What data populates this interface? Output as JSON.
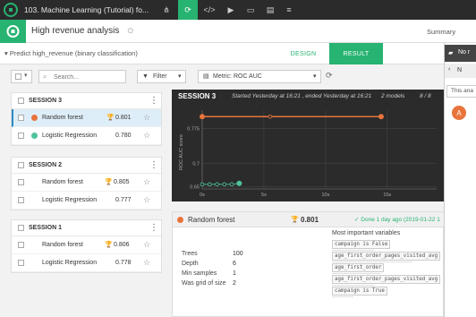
{
  "topbar": {
    "project_title": "103. Machine Learning (Tutorial) fo...",
    "icons": [
      "share-icon",
      "recycle-icon",
      "code-icon",
      "play-icon",
      "dashboard-icon",
      "notebook-icon",
      "menu-icon"
    ]
  },
  "subbar": {
    "analysis_title": "High revenue analysis",
    "summary_label": "Summary"
  },
  "tabbar": {
    "predict_label": "Predict high_revenue (binary classification)",
    "design_label": "DESIGN",
    "result_label": "RESULT"
  },
  "filterbar": {
    "search_placeholder": "Search...",
    "filter_label": "Filter",
    "metric_label": "Metric: ROC AUC"
  },
  "sessions": [
    {
      "title": "SESSION 3",
      "models": [
        {
          "name": "Random forest",
          "score": "0.801",
          "color": "#e8743b"
        },
        {
          "name": "Logistic Regression",
          "score": "0.780",
          "color": "#4fc39a"
        }
      ]
    },
    {
      "title": "SESSION 2",
      "models": [
        {
          "name": "Random forest",
          "score": "0.805"
        },
        {
          "name": "Logistic Regression",
          "score": "0.777"
        }
      ]
    },
    {
      "title": "SESSION 1",
      "models": [
        {
          "name": "Random forest",
          "score": "0.806"
        },
        {
          "name": "Logistic Regression",
          "score": "0.778"
        }
      ]
    }
  ],
  "chart_panel": {
    "session": "SESSION 3",
    "started": "Started Yesterday at 16:21 , ended Yesterday at 16:21",
    "models_count": "2 models",
    "progress": "8 / 8"
  },
  "chart_data": {
    "type": "line",
    "ylabel": "ROC AUC score",
    "xlabel": "",
    "x_ticks": [
      "0s",
      "5s",
      "10s",
      "15s"
    ],
    "y_ticks": [
      "0.775",
      "0.7",
      "0.65"
    ],
    "xlim": [
      0,
      19
    ],
    "series": [
      {
        "color": "#e8743b",
        "x": [
          0,
          5.5,
          14.5
        ],
        "y": [
          0.801,
          0.801,
          0.801
        ]
      },
      {
        "color": "#4fc39a",
        "x": [
          0,
          0.6,
          1.2,
          1.8,
          2.4,
          3.0
        ],
        "y": [
          0.655,
          0.655,
          0.655,
          0.655,
          0.655,
          0.657
        ]
      }
    ]
  },
  "detail": {
    "model_name": "Random forest",
    "score": "0.801",
    "done_label": "Done 1 day ago (2019-01-22 1",
    "params": [
      {
        "label": "Trees",
        "value": "100"
      },
      {
        "label": "Depth",
        "value": "6"
      },
      {
        "label": "Min samples",
        "value": "1"
      },
      {
        "label": "Was grid of size",
        "value": "2"
      }
    ],
    "vars_title": "Most important variables",
    "vars": [
      {
        "label": "campaign is False",
        "importance": 0.4
      },
      {
        "label": "age_first_order_pages_visited_avg",
        "importance": 0.75
      },
      {
        "label": "age_first_order",
        "importance": 0.45
      },
      {
        "label": "age_first_order_pages_visited_avg",
        "importance": 0.4
      },
      {
        "label": "campaign is True",
        "importance": 0.2
      }
    ]
  },
  "side_panel": {
    "header1": "No r",
    "header2": "N",
    "input_text": "This ana",
    "avatar_letter": "A"
  },
  "colors": {
    "accent": "#27b371",
    "selected": "#deeef8",
    "dark": "#2b2b2b"
  }
}
